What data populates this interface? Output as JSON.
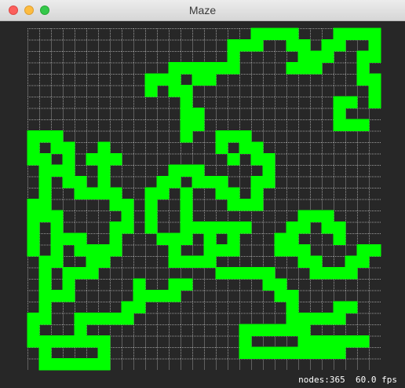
{
  "window": {
    "title": "Maze"
  },
  "status": {
    "nodes_label": "nodes:365",
    "fps_label": "60.0 fps"
  },
  "colors": {
    "background": "#272727",
    "grid": "#9a9a9a",
    "path": "#00ff00"
  },
  "maze": {
    "cols": 30,
    "rows": 30,
    "visited_nodes": 365,
    "path_cells": [
      [
        19,
        0
      ],
      [
        20,
        0
      ],
      [
        21,
        0
      ],
      [
        22,
        0
      ],
      [
        26,
        0
      ],
      [
        27,
        0
      ],
      [
        28,
        0
      ],
      [
        29,
        0
      ],
      [
        17,
        1
      ],
      [
        18,
        1
      ],
      [
        19,
        1
      ],
      [
        22,
        1
      ],
      [
        23,
        1
      ],
      [
        25,
        1
      ],
      [
        26,
        1
      ],
      [
        29,
        1
      ],
      [
        17,
        2
      ],
      [
        23,
        2
      ],
      [
        24,
        2
      ],
      [
        25,
        2
      ],
      [
        28,
        2
      ],
      [
        29,
        2
      ],
      [
        12,
        3
      ],
      [
        13,
        3
      ],
      [
        14,
        3
      ],
      [
        15,
        3
      ],
      [
        16,
        3
      ],
      [
        17,
        3
      ],
      [
        22,
        3
      ],
      [
        23,
        3
      ],
      [
        24,
        3
      ],
      [
        28,
        3
      ],
      [
        10,
        4
      ],
      [
        11,
        4
      ],
      [
        12,
        4
      ],
      [
        14,
        4
      ],
      [
        15,
        4
      ],
      [
        28,
        4
      ],
      [
        29,
        4
      ],
      [
        10,
        5
      ],
      [
        12,
        5
      ],
      [
        13,
        5
      ],
      [
        29,
        5
      ],
      [
        13,
        6
      ],
      [
        26,
        6
      ],
      [
        27,
        6
      ],
      [
        29,
        6
      ],
      [
        13,
        7
      ],
      [
        14,
        7
      ],
      [
        26,
        7
      ],
      [
        13,
        8
      ],
      [
        14,
        8
      ],
      [
        26,
        8
      ],
      [
        27,
        8
      ],
      [
        28,
        8
      ],
      [
        0,
        9
      ],
      [
        1,
        9
      ],
      [
        2,
        9
      ],
      [
        13,
        9
      ],
      [
        16,
        9
      ],
      [
        17,
        9
      ],
      [
        18,
        9
      ],
      [
        0,
        10
      ],
      [
        2,
        10
      ],
      [
        3,
        10
      ],
      [
        6,
        10
      ],
      [
        16,
        10
      ],
      [
        18,
        10
      ],
      [
        19,
        10
      ],
      [
        0,
        11
      ],
      [
        1,
        11
      ],
      [
        3,
        11
      ],
      [
        5,
        11
      ],
      [
        6,
        11
      ],
      [
        7,
        11
      ],
      [
        17,
        11
      ],
      [
        19,
        11
      ],
      [
        20,
        11
      ],
      [
        1,
        12
      ],
      [
        2,
        12
      ],
      [
        3,
        12
      ],
      [
        6,
        12
      ],
      [
        12,
        12
      ],
      [
        13,
        12
      ],
      [
        14,
        12
      ],
      [
        20,
        12
      ],
      [
        1,
        13
      ],
      [
        3,
        13
      ],
      [
        4,
        13
      ],
      [
        6,
        13
      ],
      [
        11,
        13
      ],
      [
        12,
        13
      ],
      [
        14,
        13
      ],
      [
        15,
        13
      ],
      [
        16,
        13
      ],
      [
        19,
        13
      ],
      [
        20,
        13
      ],
      [
        1,
        14
      ],
      [
        4,
        14
      ],
      [
        5,
        14
      ],
      [
        6,
        14
      ],
      [
        7,
        14
      ],
      [
        10,
        14
      ],
      [
        11,
        14
      ],
      [
        13,
        14
      ],
      [
        16,
        14
      ],
      [
        17,
        14
      ],
      [
        19,
        14
      ],
      [
        0,
        15
      ],
      [
        1,
        15
      ],
      [
        7,
        15
      ],
      [
        8,
        15
      ],
      [
        10,
        15
      ],
      [
        13,
        15
      ],
      [
        17,
        15
      ],
      [
        18,
        15
      ],
      [
        19,
        15
      ],
      [
        0,
        16
      ],
      [
        1,
        16
      ],
      [
        2,
        16
      ],
      [
        8,
        16
      ],
      [
        10,
        16
      ],
      [
        13,
        16
      ],
      [
        23,
        16
      ],
      [
        24,
        16
      ],
      [
        25,
        16
      ],
      [
        0,
        17
      ],
      [
        2,
        17
      ],
      [
        7,
        17
      ],
      [
        8,
        17
      ],
      [
        10,
        17
      ],
      [
        13,
        17
      ],
      [
        14,
        17
      ],
      [
        15,
        17
      ],
      [
        16,
        17
      ],
      [
        17,
        17
      ],
      [
        18,
        17
      ],
      [
        22,
        17
      ],
      [
        23,
        17
      ],
      [
        25,
        17
      ],
      [
        26,
        17
      ],
      [
        0,
        18
      ],
      [
        2,
        18
      ],
      [
        3,
        18
      ],
      [
        4,
        18
      ],
      [
        7,
        18
      ],
      [
        11,
        18
      ],
      [
        12,
        18
      ],
      [
        13,
        18
      ],
      [
        15,
        18
      ],
      [
        17,
        18
      ],
      [
        21,
        18
      ],
      [
        22,
        18
      ],
      [
        26,
        18
      ],
      [
        0,
        19
      ],
      [
        2,
        19
      ],
      [
        4,
        19
      ],
      [
        5,
        19
      ],
      [
        6,
        19
      ],
      [
        7,
        19
      ],
      [
        12,
        19
      ],
      [
        15,
        19
      ],
      [
        16,
        19
      ],
      [
        17,
        19
      ],
      [
        21,
        19
      ],
      [
        22,
        19
      ],
      [
        23,
        19
      ],
      [
        28,
        19
      ],
      [
        29,
        19
      ],
      [
        1,
        20
      ],
      [
        2,
        20
      ],
      [
        5,
        20
      ],
      [
        6,
        20
      ],
      [
        12,
        20
      ],
      [
        13,
        20
      ],
      [
        14,
        20
      ],
      [
        15,
        20
      ],
      [
        23,
        20
      ],
      [
        24,
        20
      ],
      [
        27,
        20
      ],
      [
        28,
        20
      ],
      [
        1,
        21
      ],
      [
        3,
        21
      ],
      [
        4,
        21
      ],
      [
        5,
        21
      ],
      [
        16,
        21
      ],
      [
        17,
        21
      ],
      [
        18,
        21
      ],
      [
        19,
        21
      ],
      [
        20,
        21
      ],
      [
        24,
        21
      ],
      [
        25,
        21
      ],
      [
        26,
        21
      ],
      [
        27,
        21
      ],
      [
        1,
        22
      ],
      [
        3,
        22
      ],
      [
        9,
        22
      ],
      [
        12,
        22
      ],
      [
        13,
        22
      ],
      [
        20,
        22
      ],
      [
        21,
        22
      ],
      [
        1,
        23
      ],
      [
        2,
        23
      ],
      [
        3,
        23
      ],
      [
        9,
        23
      ],
      [
        10,
        23
      ],
      [
        11,
        23
      ],
      [
        12,
        23
      ],
      [
        21,
        23
      ],
      [
        22,
        23
      ],
      [
        1,
        24
      ],
      [
        8,
        24
      ],
      [
        9,
        24
      ],
      [
        22,
        24
      ],
      [
        26,
        24
      ],
      [
        27,
        24
      ],
      [
        0,
        25
      ],
      [
        1,
        25
      ],
      [
        4,
        25
      ],
      [
        5,
        25
      ],
      [
        6,
        25
      ],
      [
        7,
        25
      ],
      [
        8,
        25
      ],
      [
        22,
        25
      ],
      [
        23,
        25
      ],
      [
        24,
        25
      ],
      [
        25,
        25
      ],
      [
        26,
        25
      ],
      [
        0,
        26
      ],
      [
        4,
        26
      ],
      [
        18,
        26
      ],
      [
        19,
        26
      ],
      [
        20,
        26
      ],
      [
        21,
        26
      ],
      [
        22,
        26
      ],
      [
        23,
        26
      ],
      [
        0,
        27
      ],
      [
        1,
        27
      ],
      [
        2,
        27
      ],
      [
        3,
        27
      ],
      [
        4,
        27
      ],
      [
        5,
        27
      ],
      [
        6,
        27
      ],
      [
        18,
        27
      ],
      [
        23,
        27
      ],
      [
        24,
        27
      ],
      [
        25,
        27
      ],
      [
        26,
        27
      ],
      [
        27,
        27
      ],
      [
        28,
        27
      ],
      [
        1,
        28
      ],
      [
        6,
        28
      ],
      [
        18,
        28
      ],
      [
        19,
        28
      ],
      [
        20,
        28
      ],
      [
        21,
        28
      ],
      [
        22,
        28
      ],
      [
        23,
        28
      ],
      [
        24,
        28
      ],
      [
        25,
        28
      ],
      [
        26,
        28
      ],
      [
        1,
        29
      ],
      [
        2,
        29
      ],
      [
        3,
        29
      ],
      [
        4,
        29
      ],
      [
        5,
        29
      ],
      [
        6,
        29
      ]
    ]
  }
}
